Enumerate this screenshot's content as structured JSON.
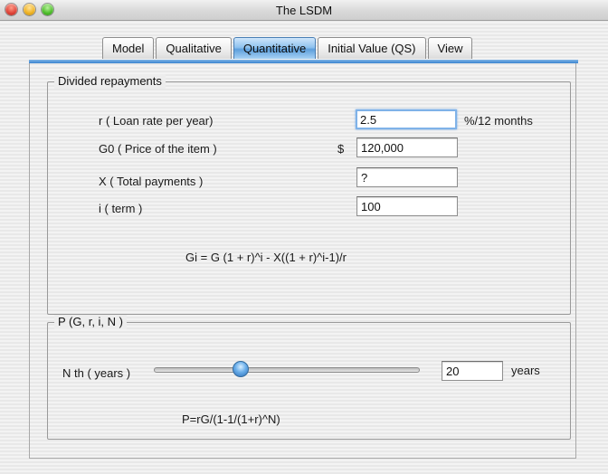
{
  "window": {
    "title": "The LSDM"
  },
  "tabs": [
    {
      "label": "Model",
      "active": false
    },
    {
      "label": "Qualitative",
      "active": false
    },
    {
      "label": "Quantitative",
      "active": true
    },
    {
      "label": "Initial Value (QS)",
      "active": false
    },
    {
      "label": "View",
      "active": false
    }
  ],
  "repayments": {
    "legend": "Divided repayments",
    "rate_label": "r  ( Loan rate per year)",
    "rate_value": "2.5",
    "rate_unit": "%/12 months",
    "price_label": "G0 ( Price of the item )",
    "currency": "$",
    "price_value": "120,000",
    "payments_label": "X ( Total payments )",
    "payments_value": "?",
    "term_label": "i ( term )",
    "term_value": "100",
    "formula": "Gi = G (1 + r)^i - X((1 + r)^i-1)/r"
  },
  "pgroup": {
    "legend": "P (G, r, i, N )",
    "nth_label": "N th ( years )",
    "slider_fraction": 0.3,
    "years_value": "20",
    "years_unit": "years",
    "formula": "P=rG/(1-1/(1+r)^N)"
  }
}
